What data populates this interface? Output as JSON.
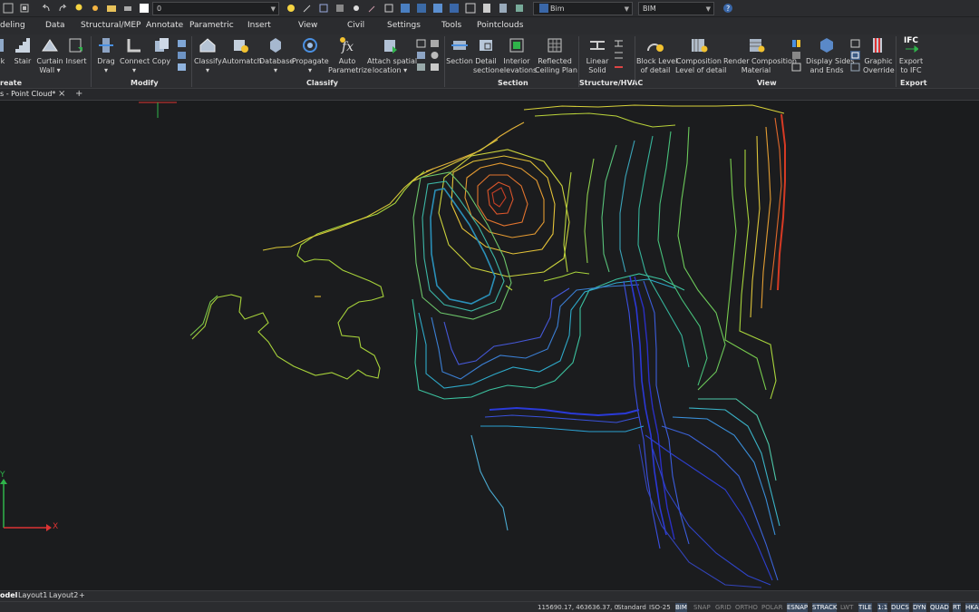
{
  "toolbar": {
    "layer_value": "0",
    "workspace_value": "Bim",
    "profile_value": "BIM"
  },
  "tabs": [
    "deling",
    "Data",
    "Structural/MEP",
    "Annotate",
    "Parametric",
    "Insert",
    "View",
    "Civil",
    "Settings",
    "Tools",
    "Pointclouds"
  ],
  "ribbon": {
    "create": {
      "group": "reate",
      "buttons": [
        "k",
        "Stair",
        "Curtain\nWall ▾",
        "Insert"
      ]
    },
    "modify": {
      "group": "Modify",
      "buttons": [
        "Drag\n▾",
        "Connect\n▾",
        "Copy"
      ]
    },
    "classify": {
      "group": "Classify",
      "buttons": [
        "Classify\n▾",
        "Automatch",
        "Database\n▾",
        "Propagate\n▾",
        "Auto\nParametrize",
        "Attach spatial\nlocation ▾"
      ]
    },
    "section": {
      "group": "Section",
      "buttons": [
        "Section",
        "Detail\nsection",
        "Interior\nelevations",
        "Reflected\nCeiling Plan"
      ]
    },
    "structure": {
      "group": "Structure/HVAC",
      "buttons": [
        "Linear\nSolid"
      ]
    },
    "view": {
      "group": "View",
      "buttons": [
        "Block Level\nof detail",
        "Composition\nLevel of detail",
        "Render Composition\nMaterial",
        "Display Sides\nand Ends",
        "Graphic\nOverride"
      ]
    },
    "export": {
      "group": "Export",
      "buttons": [
        "Export\nto IFC"
      ],
      "badge": "IFC"
    }
  },
  "doc_tab": {
    "label": "s - Point Cloud*",
    "close": "×",
    "add": "+"
  },
  "layout_tabs": [
    "odel",
    "Layout1",
    "Layout2",
    "+"
  ],
  "status": {
    "coords": "115690.17, 463636.37, 0",
    "style": "Standard",
    "dimstyle": "ISO-25",
    "toggles": [
      "BIM",
      "SNAP",
      "GRID",
      "ORTHO",
      "POLAR",
      "ESNAP",
      "STRACK",
      "LWT",
      "TILE",
      "1:1",
      "DUCS",
      "DYN",
      "QUAD",
      "RT",
      "HKA"
    ],
    "active": [
      "BIM",
      "ESNAP",
      "STRACK",
      "TILE",
      "1:1",
      "DUCS",
      "DYN",
      "QUAD",
      "RT",
      "HKA"
    ]
  },
  "axis": {
    "y": "Y",
    "x": "X"
  },
  "colors": {
    "accent": "#4a90e2",
    "canvas": "#1b1c1e",
    "ribbon": "#2d2e31"
  }
}
